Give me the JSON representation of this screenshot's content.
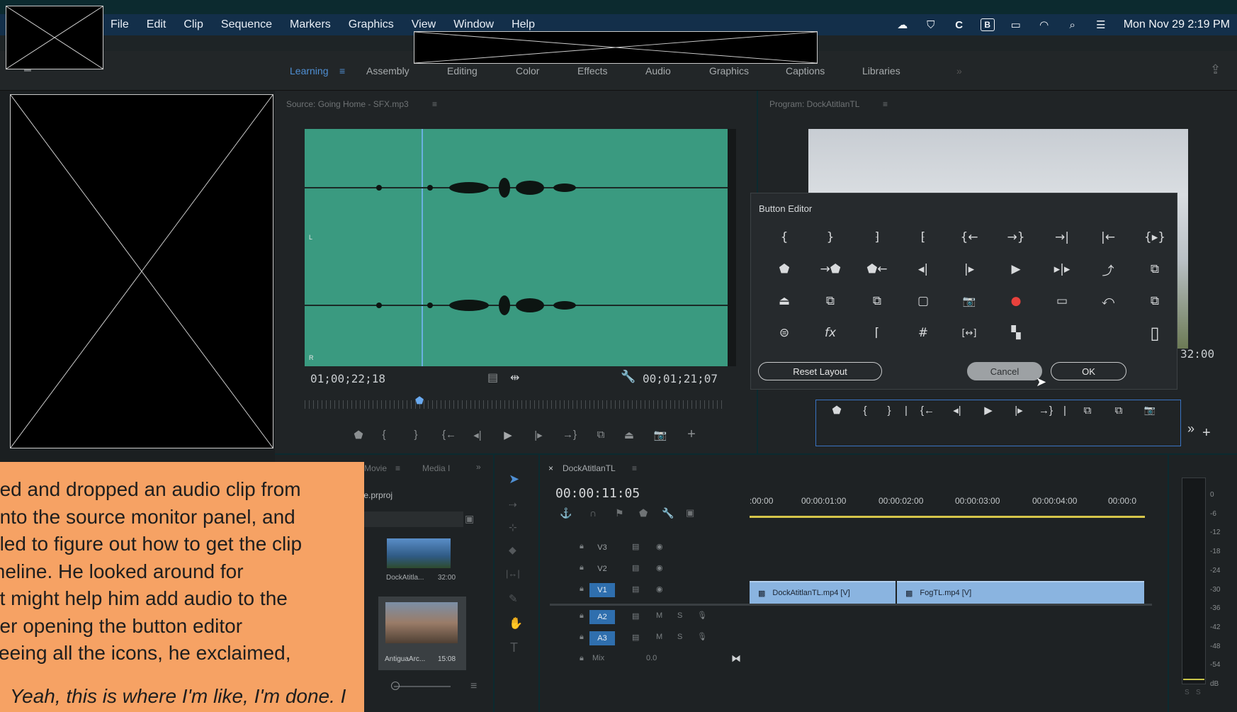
{
  "menubar": {
    "items": [
      "File",
      "Edit",
      "Clip",
      "Sequence",
      "Markers",
      "Graphics",
      "View",
      "Window",
      "Help"
    ],
    "clock": "Mon Nov 29  2:19 PM"
  },
  "workspaces": {
    "tabs": [
      "Learning",
      "Assembly",
      "Editing",
      "Color",
      "Effects",
      "Audio",
      "Graphics",
      "Captions",
      "Libraries"
    ],
    "active": "Learning",
    "overflow": "»"
  },
  "source_monitor": {
    "title": "Source: Going Home - SFX.mp3",
    "menu_glyph": "≡",
    "timecode_in": "01;00;22;18",
    "timecode_out": "00;01;21;07",
    "channel_left": "L",
    "channel_right": "R"
  },
  "program_monitor": {
    "title": "Program: DockAtitlanTL",
    "menu_glyph": "≡",
    "timecode_partial": "32:00"
  },
  "button_editor": {
    "title": "Button Editor",
    "rows": [
      [
        "{",
        "}",
        "⁆",
        "⁅",
        "{←",
        "→}",
        "→|",
        "|←",
        "{▸}"
      ],
      [
        "⬟",
        "→⬟",
        "⬟←",
        "◂|",
        "|▸",
        "▶",
        "▸|▸",
        "⤴",
        "⧉"
      ],
      [
        "⏏",
        "⧉",
        "⧉",
        "▢",
        "📷",
        "●",
        "▭",
        "⤺",
        "⧉"
      ],
      [
        "⊜",
        "fx",
        "⌈",
        "#",
        "[↔]",
        "▚",
        "",
        "",
        "▯"
      ]
    ],
    "reset_label": "Reset Layout",
    "cancel_label": "Cancel",
    "ok_label": "OK",
    "record_color": "#e8413c"
  },
  "program_transport": {
    "buttons": [
      "⬟",
      "{",
      "}",
      "|",
      "{←",
      "◂|",
      "▶",
      "|▸",
      "→}",
      "|",
      "⧉",
      "⧉",
      "📷"
    ],
    "overflow": "»",
    "add": "+"
  },
  "source_transport": {
    "buttons": [
      "⬟",
      "{",
      "}",
      "{←",
      "◂|",
      "▶",
      "|▸",
      "→}",
      "⧉",
      "⏏",
      "📷"
    ],
    "add": "+"
  },
  "project_panel": {
    "tab1": "Movie",
    "tab2": "Media I",
    "overflow": "»",
    "file": "Movie.prproj",
    "items": [
      {
        "name": "DockAtitla...",
        "duration": "32:00"
      },
      {
        "name": "AntiguaArc...",
        "duration": "15:08"
      }
    ]
  },
  "timeline": {
    "close": "×",
    "title": "DockAtitlanTL",
    "menu_glyph": "≡",
    "timecode": "00:00:11:05",
    "ruler": [
      ":00:00",
      "00:00:01:00",
      "00:00:02:00",
      "00:00:03:00",
      "00:00:04:00",
      "00:00:0"
    ],
    "tracks": [
      "V3",
      "V2",
      "V1",
      "A2",
      "A3"
    ],
    "mix_label": "Mix",
    "mix_value": "0.0",
    "clips": [
      {
        "name": "DockAtitlanTL.mp4 [V]"
      },
      {
        "name": "FogTL.mp4 [V]"
      }
    ]
  },
  "meters": {
    "scale": [
      "0",
      "-6",
      "-12",
      "-18",
      "-24",
      "-30",
      "-36",
      "-42",
      "-48",
      "-54",
      "dB"
    ],
    "solo": [
      "S",
      "S"
    ]
  },
  "caption": {
    "lines": [
      "ged and dropped an audio clip from",
      "onto the source monitor panel, and",
      "gled to figure out how to get the clip",
      "meline. He looked around for",
      "at might help him add audio to the",
      "fter opening the button editor",
      "seeing all the icons, he exclaimed,"
    ],
    "quote": "Yeah, this is where I'm like, I'm done. I"
  }
}
